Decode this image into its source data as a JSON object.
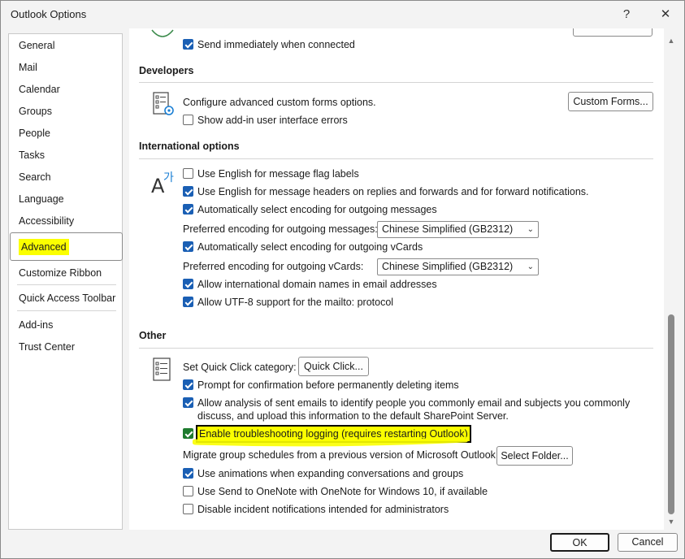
{
  "window": {
    "title": "Outlook Options",
    "help_glyph": "?",
    "close_glyph": "✕"
  },
  "sidebar": {
    "items": [
      {
        "label": "General"
      },
      {
        "label": "Mail"
      },
      {
        "label": "Calendar"
      },
      {
        "label": "Groups"
      },
      {
        "label": "People"
      },
      {
        "label": "Tasks"
      },
      {
        "label": "Search"
      },
      {
        "label": "Language"
      },
      {
        "label": "Accessibility"
      },
      {
        "label": "Advanced",
        "selected": true
      },
      {
        "label": "Customize Ribbon"
      },
      {
        "label": "Quick Access Toolbar"
      },
      {
        "label": "Add-ins"
      },
      {
        "label": "Trust Center"
      }
    ]
  },
  "top": {
    "send_immediately": "Send immediately when connected"
  },
  "developers": {
    "header": "Developers",
    "configure_label": "Configure advanced custom forms options.",
    "custom_forms_button": "Custom Forms...",
    "show_errors": "Show add-in user interface errors"
  },
  "international": {
    "header": "International options",
    "english_flag": "Use English for message flag labels",
    "english_headers": "Use English for message headers on replies and forwards and for forward notifications.",
    "auto_encoding": "Automatically select encoding for outgoing messages",
    "pref_encoding_label": "Preferred encoding for outgoing messages:",
    "pref_encoding_value": "Chinese Simplified (GB2312)",
    "auto_vcards": "Automatically select encoding for outgoing vCards",
    "pref_vcards_label": "Preferred encoding for outgoing vCards:",
    "pref_vcards_value": "Chinese Simplified (GB2312)",
    "idn": "Allow international domain names in email addresses",
    "utf8": "Allow UTF-8 support for the mailto: protocol"
  },
  "other": {
    "header": "Other",
    "quick_click_label": "Set Quick Click category:",
    "quick_click_button": "Quick Click...",
    "confirm_delete": "Prompt for confirmation before permanently deleting items",
    "analysis_line1": "Allow analysis of sent emails to identify people you commonly email and subjects you commonly",
    "analysis_line2": "discuss, and upload this information to the default SharePoint Server.",
    "troubleshooting": "Enable troubleshooting logging (requires restarting Outlook)",
    "migrate_label": "Migrate group schedules from a previous version of Microsoft Outlook:",
    "select_folder_button": "Select Folder...",
    "animations": "Use animations when expanding conversations and groups",
    "send_onenote": "Use Send to OneNote with OneNote for Windows 10, if available",
    "disable_incident": "Disable incident notifications intended for administrators"
  },
  "footer": {
    "ok": "OK",
    "cancel": "Cancel"
  },
  "colors": {
    "checkbox_accent": "#1a5fb4",
    "highlight": "#fbff00",
    "troubleshooting_check": "#1e7b2f"
  }
}
